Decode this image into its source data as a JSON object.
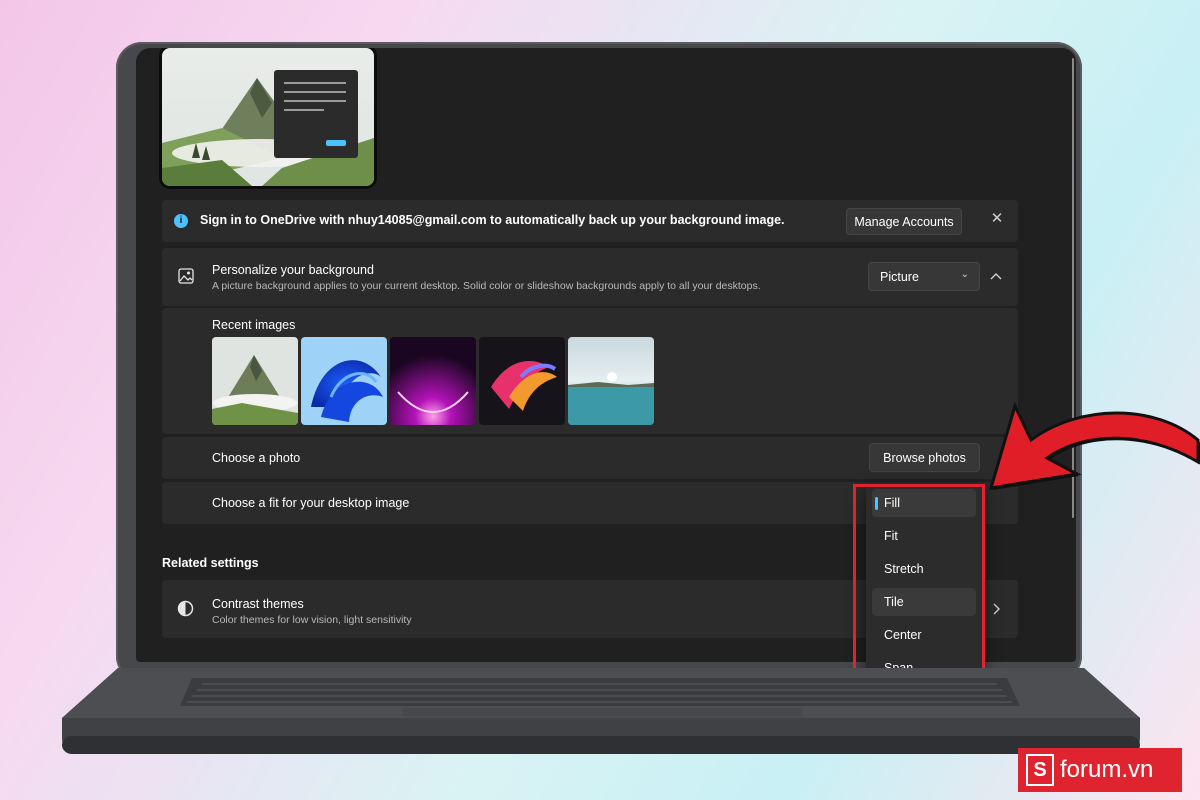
{
  "notice": {
    "text": "Sign in to OneDrive with nhuy14085@gmail.com to automatically back up your background image.",
    "manage_button": "Manage Accounts",
    "close_icon": "close-icon",
    "info_icon": "info-icon"
  },
  "personalize": {
    "title": "Personalize your background",
    "subtitle": "A picture background applies to your current desktop. Solid color or slideshow backgrounds apply to all your desktops.",
    "dropdown_value": "Picture",
    "icon": "image-icon"
  },
  "recent": {
    "label": "Recent images",
    "thumbnails": [
      "mountain-landscape",
      "windows-bloom-blue",
      "purple-glow-arc",
      "colorful-ribbon",
      "lake-sunrise"
    ]
  },
  "choose_photo": {
    "label": "Choose a photo",
    "button": "Browse photos"
  },
  "choose_fit": {
    "label": "Choose a fit for your desktop image",
    "options": [
      "Fill",
      "Fit",
      "Stretch",
      "Tile",
      "Center",
      "Span"
    ],
    "selected": "Fill",
    "hovered": "Tile"
  },
  "related": {
    "heading": "Related settings",
    "contrast_title": "Contrast themes",
    "contrast_subtitle": "Color themes for low vision, light sensitivity"
  },
  "watermark": {
    "logo_letter": "S",
    "text": "forum.vn"
  },
  "colors": {
    "accent": "#4cc2ff",
    "highlight_red": "#e0242f",
    "arrow_red": "#e01e28"
  }
}
